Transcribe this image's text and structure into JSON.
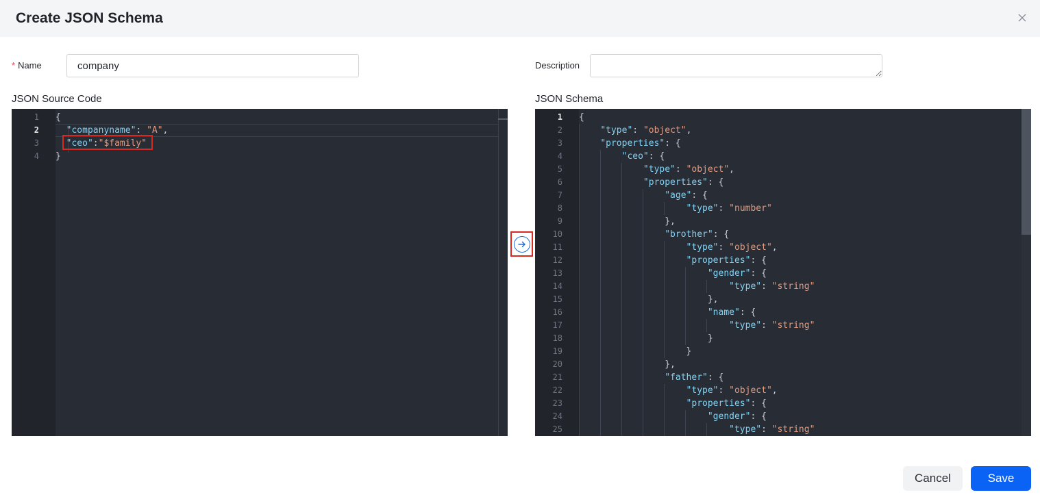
{
  "dialog": {
    "title": "Create JSON Schema",
    "close_icon": "close-icon"
  },
  "form": {
    "name_required_mark": "*",
    "name_label": "Name",
    "name_value": "company",
    "description_label": "Description",
    "description_value": ""
  },
  "source_editor": {
    "label": "JSON Source Code",
    "active_line": 2,
    "lines": [
      {
        "n": "1",
        "tokens": [
          {
            "t": "p",
            "v": "{"
          }
        ]
      },
      {
        "n": "2",
        "tokens": [
          {
            "t": "p",
            "v": "  "
          },
          {
            "t": "k",
            "v": "\"companyname\""
          },
          {
            "t": "p",
            "v": ": "
          },
          {
            "t": "s",
            "v": "\"A\""
          },
          {
            "t": "p",
            "v": ","
          }
        ]
      },
      {
        "n": "3",
        "tokens": [
          {
            "t": "p",
            "v": "  "
          },
          {
            "t": "k",
            "v": "\"ceo\""
          },
          {
            "t": "p",
            "v": ":"
          },
          {
            "t": "s",
            "v": "\"$family\""
          }
        ]
      },
      {
        "n": "4",
        "tokens": [
          {
            "t": "p",
            "v": "}"
          }
        ]
      }
    ]
  },
  "convert_button": {
    "icon": "arrow-right-circle-icon"
  },
  "schema_editor": {
    "label": "JSON Schema",
    "active_line": 1,
    "lines": [
      {
        "n": "1",
        "tokens": [
          {
            "t": "p",
            "v": "{"
          }
        ]
      },
      {
        "n": "2",
        "tokens": [
          {
            "t": "p",
            "v": "    "
          },
          {
            "t": "k",
            "v": "\"type\""
          },
          {
            "t": "p",
            "v": ": "
          },
          {
            "t": "s",
            "v": "\"object\""
          },
          {
            "t": "p",
            "v": ","
          }
        ]
      },
      {
        "n": "3",
        "tokens": [
          {
            "t": "p",
            "v": "    "
          },
          {
            "t": "k",
            "v": "\"properties\""
          },
          {
            "t": "p",
            "v": ": {"
          }
        ]
      },
      {
        "n": "4",
        "tokens": [
          {
            "t": "p",
            "v": "        "
          },
          {
            "t": "k",
            "v": "\"ceo\""
          },
          {
            "t": "p",
            "v": ": {"
          }
        ]
      },
      {
        "n": "5",
        "tokens": [
          {
            "t": "p",
            "v": "            "
          },
          {
            "t": "k",
            "v": "\"type\""
          },
          {
            "t": "p",
            "v": ": "
          },
          {
            "t": "s",
            "v": "\"object\""
          },
          {
            "t": "p",
            "v": ","
          }
        ]
      },
      {
        "n": "6",
        "tokens": [
          {
            "t": "p",
            "v": "            "
          },
          {
            "t": "k",
            "v": "\"properties\""
          },
          {
            "t": "p",
            "v": ": {"
          }
        ]
      },
      {
        "n": "7",
        "tokens": [
          {
            "t": "p",
            "v": "                "
          },
          {
            "t": "k",
            "v": "\"age\""
          },
          {
            "t": "p",
            "v": ": {"
          }
        ]
      },
      {
        "n": "8",
        "tokens": [
          {
            "t": "p",
            "v": "                    "
          },
          {
            "t": "k",
            "v": "\"type\""
          },
          {
            "t": "p",
            "v": ": "
          },
          {
            "t": "s",
            "v": "\"number\""
          }
        ]
      },
      {
        "n": "9",
        "tokens": [
          {
            "t": "p",
            "v": "                },"
          }
        ]
      },
      {
        "n": "10",
        "tokens": [
          {
            "t": "p",
            "v": "                "
          },
          {
            "t": "k",
            "v": "\"brother\""
          },
          {
            "t": "p",
            "v": ": {"
          }
        ]
      },
      {
        "n": "11",
        "tokens": [
          {
            "t": "p",
            "v": "                    "
          },
          {
            "t": "k",
            "v": "\"type\""
          },
          {
            "t": "p",
            "v": ": "
          },
          {
            "t": "s",
            "v": "\"object\""
          },
          {
            "t": "p",
            "v": ","
          }
        ]
      },
      {
        "n": "12",
        "tokens": [
          {
            "t": "p",
            "v": "                    "
          },
          {
            "t": "k",
            "v": "\"properties\""
          },
          {
            "t": "p",
            "v": ": {"
          }
        ]
      },
      {
        "n": "13",
        "tokens": [
          {
            "t": "p",
            "v": "                        "
          },
          {
            "t": "k",
            "v": "\"gender\""
          },
          {
            "t": "p",
            "v": ": {"
          }
        ]
      },
      {
        "n": "14",
        "tokens": [
          {
            "t": "p",
            "v": "                            "
          },
          {
            "t": "k",
            "v": "\"type\""
          },
          {
            "t": "p",
            "v": ": "
          },
          {
            "t": "s",
            "v": "\"string\""
          }
        ]
      },
      {
        "n": "15",
        "tokens": [
          {
            "t": "p",
            "v": "                        },"
          }
        ]
      },
      {
        "n": "16",
        "tokens": [
          {
            "t": "p",
            "v": "                        "
          },
          {
            "t": "k",
            "v": "\"name\""
          },
          {
            "t": "p",
            "v": ": {"
          }
        ]
      },
      {
        "n": "17",
        "tokens": [
          {
            "t": "p",
            "v": "                            "
          },
          {
            "t": "k",
            "v": "\"type\""
          },
          {
            "t": "p",
            "v": ": "
          },
          {
            "t": "s",
            "v": "\"string\""
          }
        ]
      },
      {
        "n": "18",
        "tokens": [
          {
            "t": "p",
            "v": "                        }"
          }
        ]
      },
      {
        "n": "19",
        "tokens": [
          {
            "t": "p",
            "v": "                    }"
          }
        ]
      },
      {
        "n": "20",
        "tokens": [
          {
            "t": "p",
            "v": "                },"
          }
        ]
      },
      {
        "n": "21",
        "tokens": [
          {
            "t": "p",
            "v": "                "
          },
          {
            "t": "k",
            "v": "\"father\""
          },
          {
            "t": "p",
            "v": ": {"
          }
        ]
      },
      {
        "n": "22",
        "tokens": [
          {
            "t": "p",
            "v": "                    "
          },
          {
            "t": "k",
            "v": "\"type\""
          },
          {
            "t": "p",
            "v": ": "
          },
          {
            "t": "s",
            "v": "\"object\""
          },
          {
            "t": "p",
            "v": ","
          }
        ]
      },
      {
        "n": "23",
        "tokens": [
          {
            "t": "p",
            "v": "                    "
          },
          {
            "t": "k",
            "v": "\"properties\""
          },
          {
            "t": "p",
            "v": ": {"
          }
        ]
      },
      {
        "n": "24",
        "tokens": [
          {
            "t": "p",
            "v": "                        "
          },
          {
            "t": "k",
            "v": "\"gender\""
          },
          {
            "t": "p",
            "v": ": {"
          }
        ]
      },
      {
        "n": "25",
        "tokens": [
          {
            "t": "p",
            "v": "                            "
          },
          {
            "t": "k",
            "v": "\"type\""
          },
          {
            "t": "p",
            "v": ": "
          },
          {
            "t": "s",
            "v": "\"string\""
          }
        ]
      }
    ]
  },
  "footer": {
    "cancel_label": "Cancel",
    "save_label": "Save"
  },
  "colors": {
    "primary": "#0b63f6",
    "highlight": "#d9281f",
    "editor_bg": "#282c34",
    "key": "#7fd2f5",
    "string": "#e39a7f"
  }
}
